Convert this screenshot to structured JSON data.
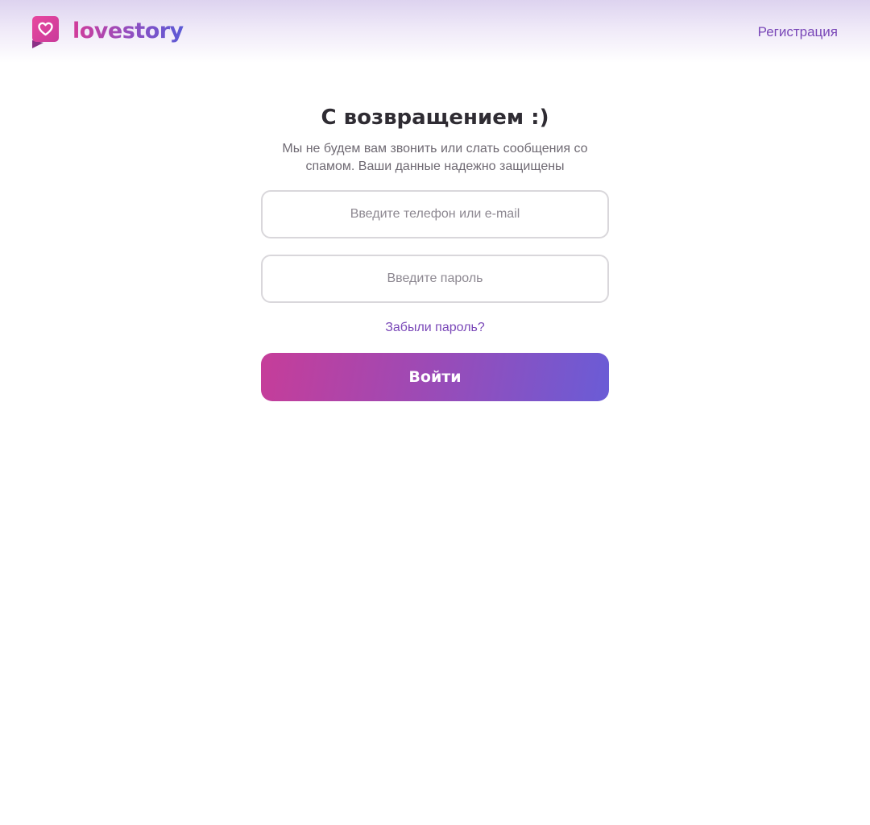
{
  "header": {
    "logo_text": "lovestory",
    "logo_icon": "heart-speech-bubble-icon",
    "register_label": "Регистрация"
  },
  "main": {
    "title": "С возвращением :)",
    "subtitle": "Мы не будем вам звонить или слать сообщения со спамом. Ваши данные надежно защищены",
    "login_placeholder": "Введите телефон или e-mail",
    "login_value": "",
    "password_placeholder": "Введите пароль",
    "password_value": "",
    "forgot_label": "Забыли пароль?",
    "submit_label": "Войти"
  },
  "colors": {
    "accent": "#7a48b8",
    "brand_pink": "#d23c9a",
    "brand_blue": "#6a5cd6",
    "title_text": "#2f2c33",
    "muted_text": "#6f6a73",
    "field_border": "#d9d7db"
  }
}
